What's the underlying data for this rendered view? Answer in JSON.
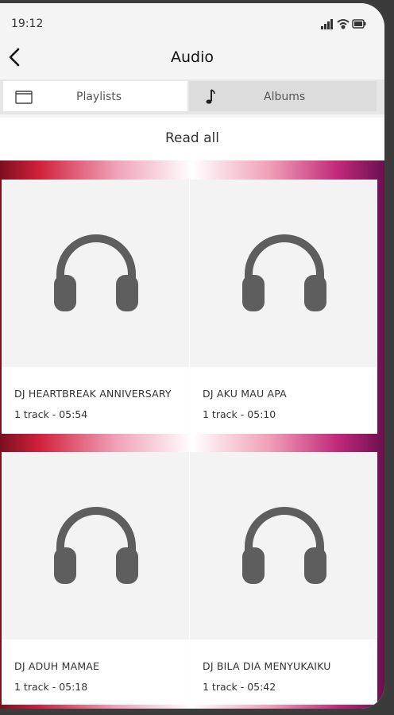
{
  "status_bar": {
    "time": "19:12"
  },
  "header": {
    "title": "Audio"
  },
  "tabs": [
    {
      "label": "Playlists",
      "icon": "playlist-icon"
    },
    {
      "label": "Albums",
      "icon": "music-note-icon"
    }
  ],
  "read_all_label": "Read all",
  "albums": [
    {
      "title": "DJ HEARTBREAK ANNIVERSARY",
      "meta": "1 track - 05:54",
      "icon": "headphones-icon"
    },
    {
      "title": "DJ AKU MAU APA",
      "meta": "1 track - 05:10",
      "icon": "headphones-icon"
    },
    {
      "title": "DJ ADUH MAMAE",
      "meta": "1 track - 05:18",
      "icon": "headphones-icon"
    },
    {
      "title": "DJ BILA DIA MENYUKAIKU",
      "meta": "1 track - 05:42",
      "icon": "headphones-icon"
    }
  ],
  "colors": {
    "icon_gray": "#5e5e5e",
    "card_bg": "#f3f3f3"
  }
}
